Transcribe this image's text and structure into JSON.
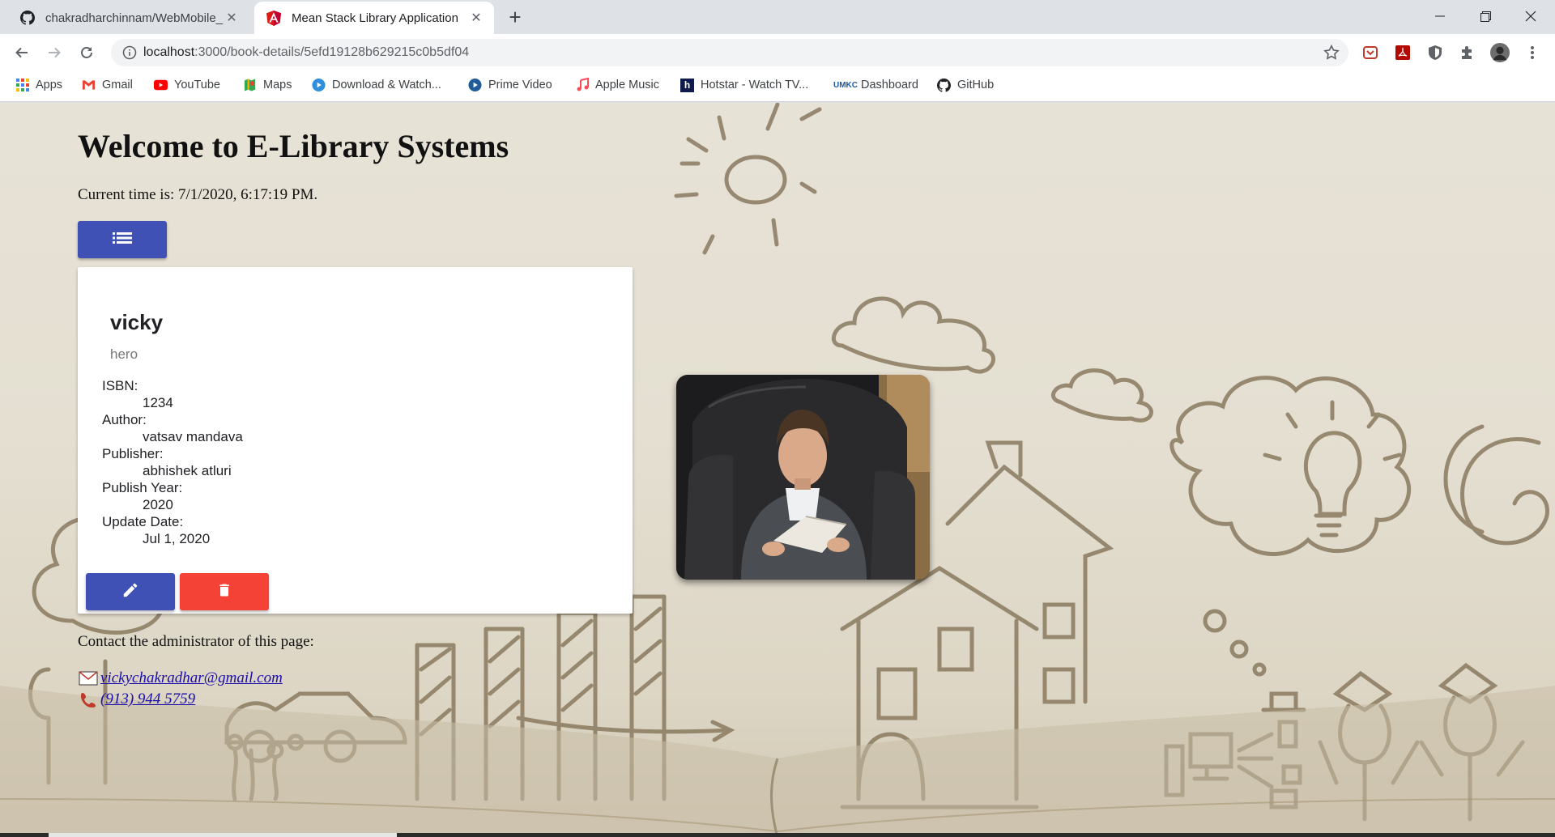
{
  "browser": {
    "tabs": [
      {
        "title": "chakradharchinnam/WebMobile_",
        "icon": "github-icon",
        "active": false
      },
      {
        "title": "Mean Stack Library Application",
        "icon": "angular-icon",
        "active": true
      }
    ],
    "address": {
      "host": "localhost",
      "path": ":3000/book-details/5efd19128b629215c0b5df04"
    },
    "bookmarks": [
      {
        "label": "Apps",
        "icon": "apps-grid-icon"
      },
      {
        "label": "Gmail",
        "icon": "gmail-icon"
      },
      {
        "label": "YouTube",
        "icon": "youtube-icon"
      },
      {
        "label": "Maps",
        "icon": "maps-icon"
      },
      {
        "label": "Download & Watch...",
        "icon": "play-circle-icon"
      },
      {
        "label": "Prime Video",
        "icon": "prime-video-icon"
      },
      {
        "label": "Apple Music",
        "icon": "music-note-icon"
      },
      {
        "label": "Hotstar - Watch TV...",
        "icon": "hotstar-icon"
      },
      {
        "label": "Dashboard",
        "icon": "umkc-icon"
      },
      {
        "label": "GitHub",
        "icon": "github-icon"
      }
    ]
  },
  "page": {
    "heading": "Welcome to E-Library Systems",
    "clock": "Current time is: 7/1/2020, 6:17:19 PM.",
    "book": {
      "title": "vicky",
      "subtitle": "hero",
      "fields": [
        {
          "label": "ISBN:",
          "value": "1234"
        },
        {
          "label": "Author:",
          "value": "vatsav mandava"
        },
        {
          "label": "Publisher:",
          "value": "abhishek atluri"
        },
        {
          "label": "Publish Year:",
          "value": "2020"
        },
        {
          "label": "Update Date:",
          "value": "Jul 1, 2020"
        }
      ]
    },
    "contact": {
      "text": "Contact the administrator of this page:",
      "email": "vickychakradhar@gmail.com",
      "phone": "(913) 944 5759"
    },
    "colors": {
      "primary": "#3f51b5",
      "warn": "#f44336",
      "link": "#1a0dab"
    }
  }
}
